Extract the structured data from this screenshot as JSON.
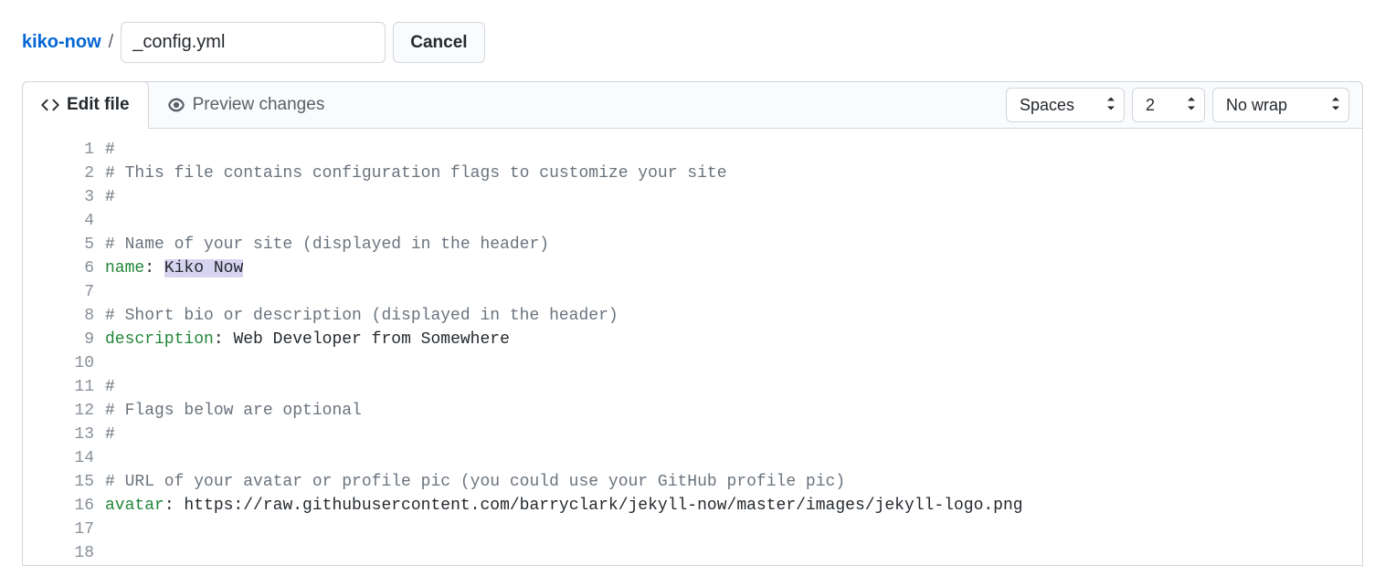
{
  "breadcrumb": {
    "repo": "kiko-now",
    "filename": "_config.yml",
    "cancel_label": "Cancel"
  },
  "tabs": {
    "edit_label": "Edit file",
    "preview_label": "Preview changes"
  },
  "toolbar": {
    "indent_mode": "Spaces",
    "indent_size": "2",
    "wrap_mode": "No wrap"
  },
  "code": {
    "line_numbers": [
      "1",
      "2",
      "3",
      "4",
      "5",
      "6",
      "7",
      "8",
      "9",
      "10",
      "11",
      "12",
      "13",
      "14",
      "15",
      "16",
      "17",
      "18"
    ],
    "l1": "#",
    "l2": "# This file contains configuration flags to customize your site",
    "l3": "#",
    "l4": "",
    "l5": "# Name of your site (displayed in the header)",
    "l6_key": "name",
    "l6_colon": ": ",
    "l6_val": "Kiko Now",
    "l7": "",
    "l8": "# Short bio or description (displayed in the header)",
    "l9_key": "description",
    "l9_colon": ": ",
    "l9_val": "Web Developer from Somewhere",
    "l10": "",
    "l11": "#",
    "l12": "# Flags below are optional",
    "l13": "#",
    "l14": "",
    "l15": "# URL of your avatar or profile pic (you could use your GitHub profile pic)",
    "l16_key": "avatar",
    "l16_colon": ": ",
    "l16_val": "https://raw.githubusercontent.com/barryclark/jekyll-now/master/images/jekyll-logo.png",
    "l17": ""
  }
}
